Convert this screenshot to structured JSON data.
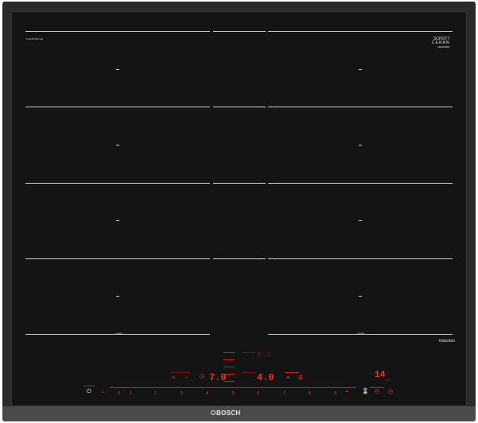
{
  "brand": {
    "name": "BOSCH",
    "ceran_line1": "SCHOTT",
    "ceran_line2": "CERAN",
    "ceran_line3": "MIRAMIRO",
    "left_mark": "PXE875DC1E"
  },
  "labels": {
    "induction": "induction",
    "vari_left": "VARI",
    "vari_right": "VARI"
  },
  "displays": {
    "left_level": "7.0",
    "center_top": "0.0",
    "center_level": "4.0",
    "timer": "14",
    "timer_unit": "min"
  },
  "power_scale": [
    "0",
    "1",
    "2",
    "3",
    "4",
    "5",
    "6",
    "7",
    "8",
    "9"
  ],
  "colors": {
    "glass": "#141414",
    "accent": "#ff2a2a",
    "frame": "#2a2a2a"
  },
  "icons": {
    "power": "power-icon",
    "childlock": "child-lock-icon",
    "boost": "boost-icon",
    "timer": "timer-icon",
    "clock": "clock-icon",
    "pan": "pan-icon",
    "frying": "frying-sensor-icon",
    "move": "move-icon",
    "wipe": "wipe-protect-icon"
  }
}
